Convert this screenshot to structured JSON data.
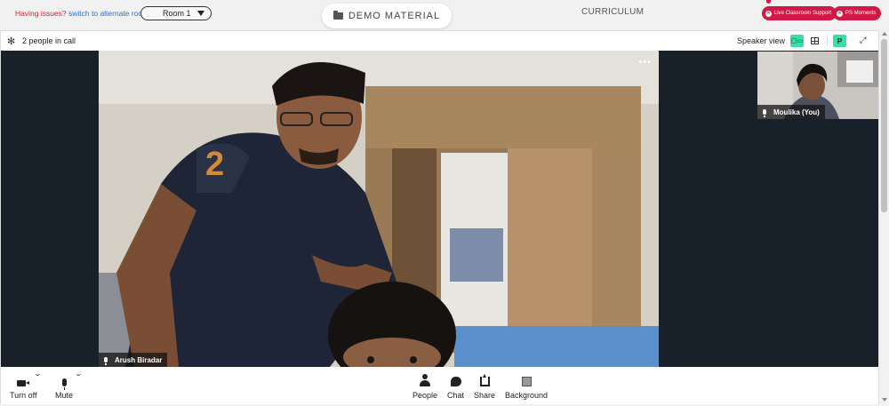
{
  "topbar": {
    "issues_text": "Having issues?",
    "alternate_link": "switch to alternate room",
    "room_select": "Room 1",
    "demo_material": "DEMO MATERIAL",
    "curriculum": "CURRICULUM",
    "live_support": "Live Classroom Support",
    "ps_moments": "PS Moments"
  },
  "call": {
    "people_count": "2 people in call",
    "view_label": "Speaker view",
    "view_speaker_btn": "▢▭",
    "presenter_btn": "P",
    "more_menu": "•••",
    "main_participant": "Arush Biradar",
    "self_participant": "Moulika (You)"
  },
  "controls": {
    "turn_off": "Turn off",
    "mute": "Mute",
    "people": "People",
    "chat": "Chat",
    "share": "Share",
    "background": "Background"
  },
  "colors": {
    "accent_green": "#38e0a6",
    "support_red": "#d11846",
    "stage_bg": "#18202a"
  }
}
